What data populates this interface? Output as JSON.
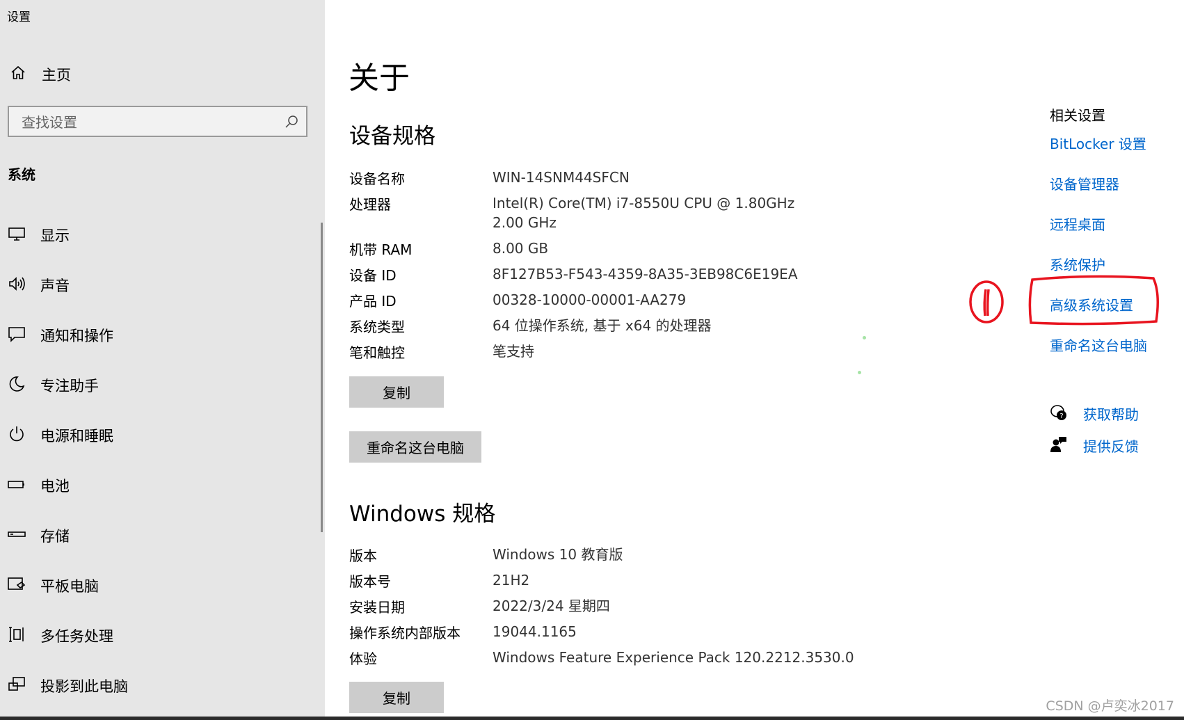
{
  "app_title": "设置",
  "sidebar": {
    "home_label": "主页",
    "search_placeholder": "查找设置",
    "section_label": "系统",
    "items": [
      {
        "label": "显示",
        "icon": "monitor-icon"
      },
      {
        "label": "声音",
        "icon": "speaker-icon"
      },
      {
        "label": "通知和操作",
        "icon": "notification-icon"
      },
      {
        "label": "专注助手",
        "icon": "moon-icon"
      },
      {
        "label": "电源和睡眠",
        "icon": "power-icon"
      },
      {
        "label": "电池",
        "icon": "battery-icon"
      },
      {
        "label": "存储",
        "icon": "storage-icon"
      },
      {
        "label": "平板电脑",
        "icon": "tablet-icon"
      },
      {
        "label": "多任务处理",
        "icon": "multitask-icon"
      },
      {
        "label": "投影到此电脑",
        "icon": "project-icon"
      }
    ]
  },
  "main": {
    "title": "关于",
    "device_specs": {
      "heading": "设备规格",
      "rows": [
        {
          "key": "设备名称",
          "value": "WIN-14SNM44SFCN"
        },
        {
          "key": "处理器",
          "value": "Intel(R) Core(TM) i7-8550U CPU @ 1.80GHz   2.00 GHz"
        },
        {
          "key": "机带 RAM",
          "value": "8.00 GB"
        },
        {
          "key": "设备 ID",
          "value": "8F127B53-F543-4359-8A35-3EB98C6E19EA"
        },
        {
          "key": "产品 ID",
          "value": "00328-10000-00001-AA279"
        },
        {
          "key": "系统类型",
          "value": "64 位操作系统, 基于 x64 的处理器"
        },
        {
          "key": "笔和触控",
          "value": "笔支持"
        }
      ],
      "copy_label": "复制",
      "rename_label": "重命名这台电脑"
    },
    "windows_specs": {
      "heading": "Windows 规格",
      "rows": [
        {
          "key": "版本",
          "value": "Windows 10 教育版"
        },
        {
          "key": "版本号",
          "value": "21H2"
        },
        {
          "key": "安装日期",
          "value": "2022/3/24 星期四"
        },
        {
          "key": "操作系统内部版本",
          "value": "19044.1165"
        },
        {
          "key": "体验",
          "value": "Windows Feature Experience Pack 120.2212.3530.0"
        }
      ],
      "copy_label": "复制"
    }
  },
  "related": {
    "heading": "相关设置",
    "links": [
      "BitLocker 设置",
      "设备管理器",
      "远程桌面",
      "系统保护",
      "高级系统设置",
      "重命名这台电脑"
    ],
    "help": {
      "label": "获取帮助",
      "icon": "help-chat-icon"
    },
    "feedback": {
      "label": "提供反馈",
      "icon": "feedback-icon"
    }
  },
  "annotation_mark": "①",
  "watermark": "CSDN @卢奕冰2017",
  "colors": {
    "link": "#0066cc",
    "sidebar_bg": "#e6e6e6",
    "button_bg": "#cccccc",
    "annotation": "#e8141f"
  }
}
